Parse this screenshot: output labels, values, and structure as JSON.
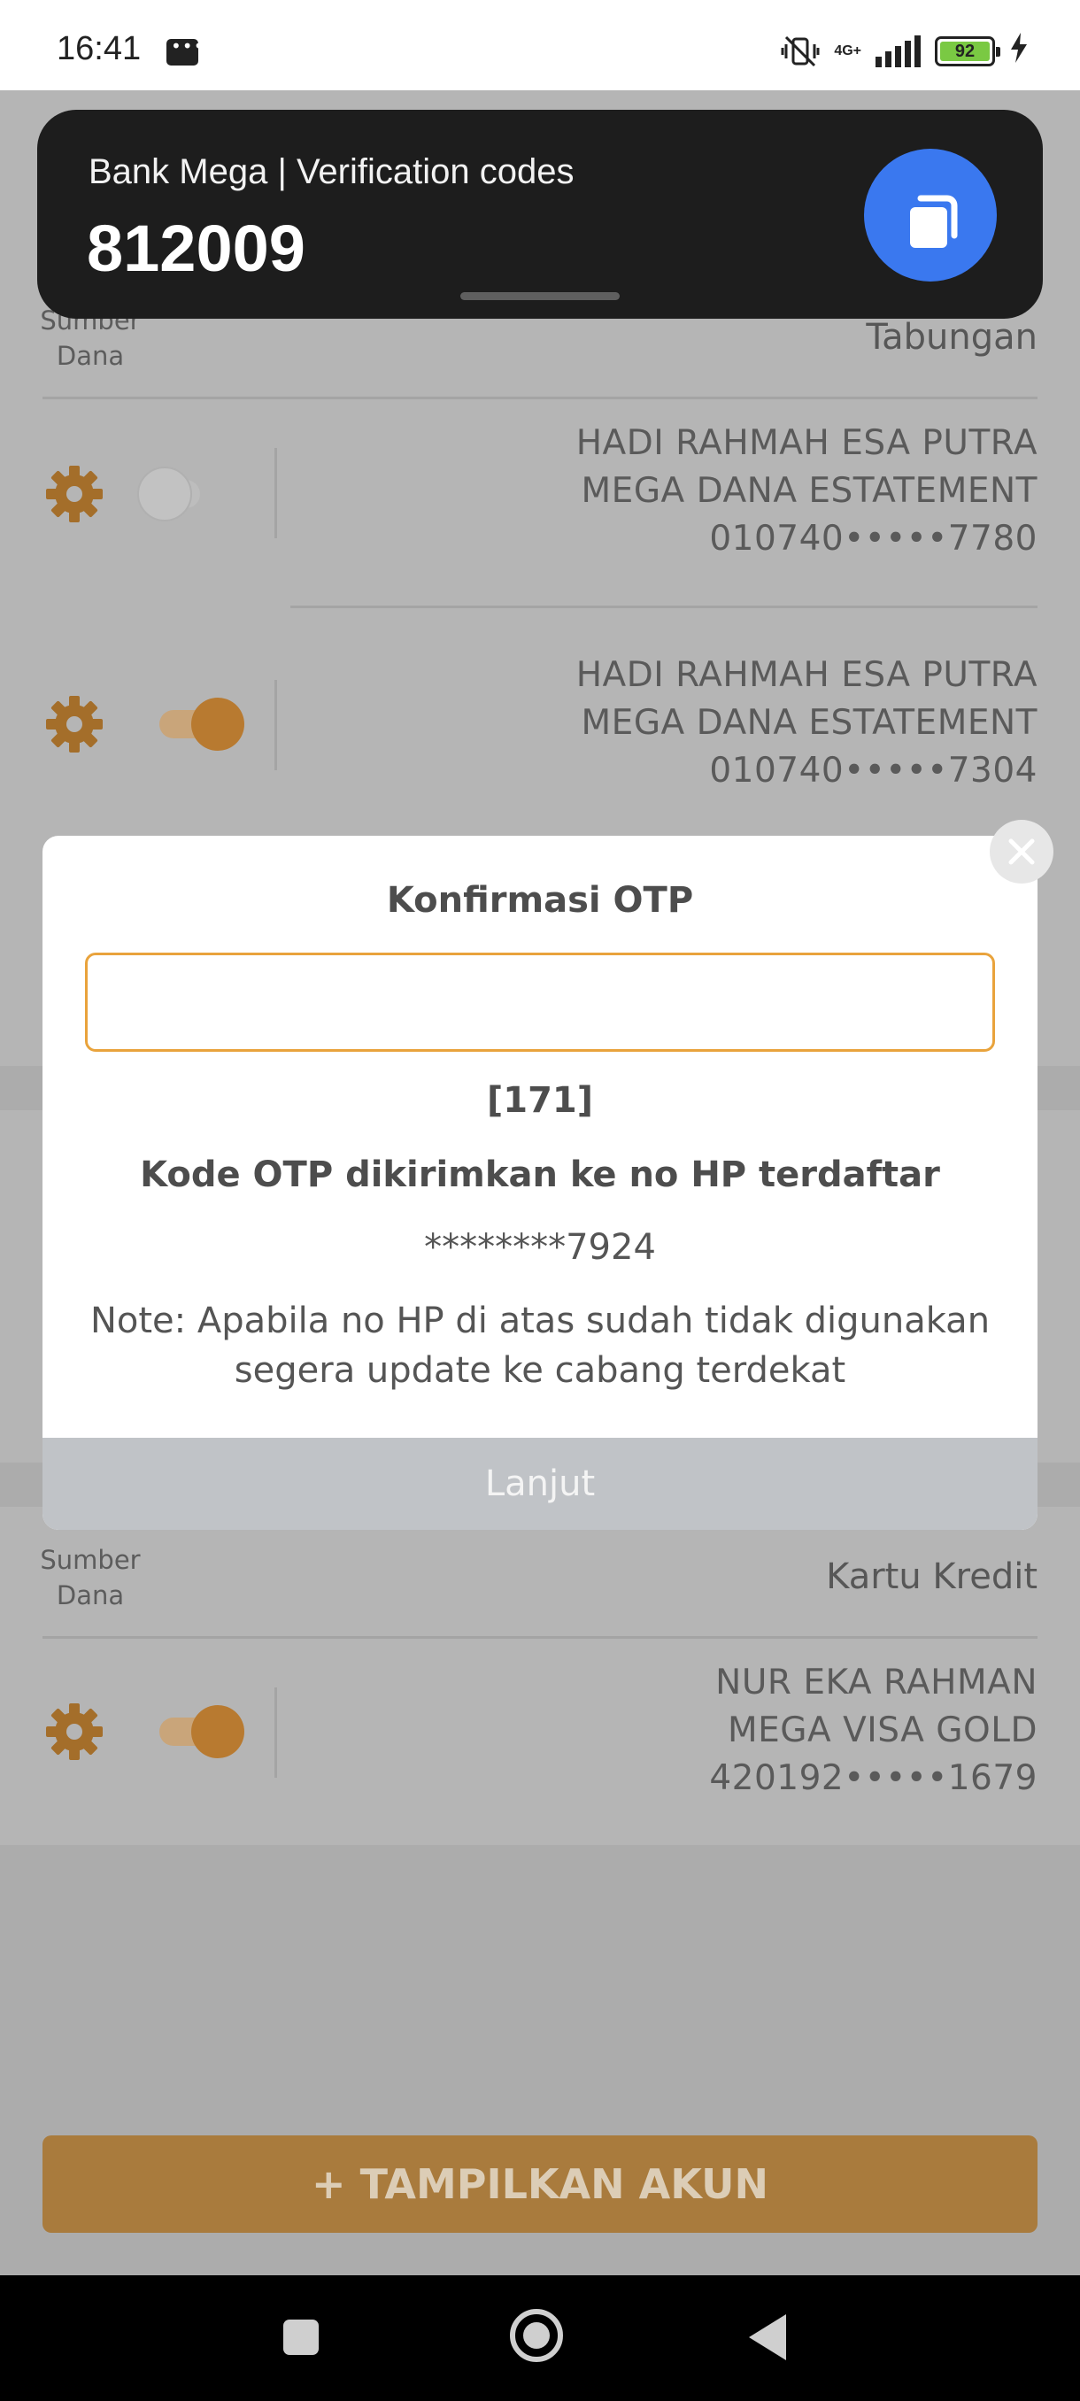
{
  "status_bar": {
    "time": "16:41",
    "network": "4G+",
    "battery": "92",
    "icons": [
      "message-icon",
      "vibrate-off-icon",
      "signal-icon",
      "battery-icon",
      "charging-icon"
    ]
  },
  "notification": {
    "title": "Bank Mega | Verification codes",
    "code": "812009",
    "copy_icon": "copy-icon"
  },
  "sections": [
    {
      "label": "Sumber\nDana",
      "value": "Tabungan",
      "accounts": [
        {
          "name": "HADI RAHMAH ESA PUTRA",
          "product": "MEGA DANA ESTATEMENT",
          "number": "010740•••••7780",
          "enabled": false
        },
        {
          "name": "HADI RAHMAH ESA PUTRA",
          "product": "MEGA DANA ESTATEMENT",
          "number": "010740•••••7304",
          "enabled": true
        }
      ]
    },
    {
      "label": "Sumber\nDana",
      "value": "Kartu Kredit",
      "accounts": [
        {
          "name": "NUR EKA RAHMAN",
          "product": "MEGA VISA GOLD",
          "number": "420192•••••1679",
          "enabled": true
        }
      ]
    }
  ],
  "show_accounts_button": "+ TAMPILKAN AKUN",
  "otp_modal": {
    "title": "Konfirmasi OTP",
    "input_value": "",
    "countdown": "[171]",
    "sent_to": "Kode OTP dikirimkan ke no HP terdaftar",
    "phone": "********7924",
    "note": "Note: Apabila no HP di atas sudah tidak digunakan segera update ke cabang terdekat",
    "continue_label": "Lanjut",
    "close_icon": "close-icon"
  },
  "colors": {
    "accent": "#e9a33c",
    "toggle_on": "#df8b2a",
    "notification_bg": "#1d1d1d",
    "copy_button": "#3a78ef",
    "primary_button": "#a97b3d"
  },
  "nav_bar": {
    "icons": [
      "recents-icon",
      "home-icon",
      "back-icon"
    ]
  }
}
